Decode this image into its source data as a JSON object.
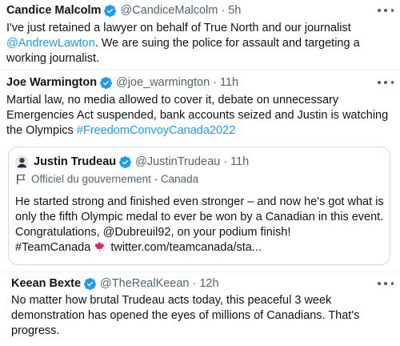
{
  "tweets": [
    {
      "name": "Candice Malcolm",
      "handle": "@CandiceMalcolm",
      "sep": "·",
      "time": "5h",
      "line1": "I've just retained a lawyer on behalf of True North and our journalist",
      "mention": "@AndrewLawton",
      "line2_rest": ". We are suing the police for assault and targeting a",
      "line3": "working journalist."
    },
    {
      "name": "Joe Warmington",
      "handle": "@joe_warmington",
      "sep": "·",
      "time": "11h",
      "line1": "Martial law, no media allowed to cover it, debate on unnecessary",
      "line2": "Emergencies Act suspended, bank accounts seized and Justin is watching",
      "line3_pre": "the Olympics ",
      "hashtag": "#FreedomConvoyCanada2022"
    },
    {
      "name": "Keean Bexte",
      "handle": "@TheRealKeean",
      "sep": "·",
      "time": "12h",
      "line1": "No matter how brutal Trudeau acts today, this peaceful 3 week",
      "line2": "demonstration has opened the eyes of millions of Canadians. That's",
      "line3": "progress."
    }
  ],
  "quote": {
    "name": "Justin Trudeau",
    "handle": "@JustinTrudeau",
    "sep": "·",
    "time": "11h",
    "gov_label": "Officiel du gouvernement - Canada",
    "line1": "He started strong and finished even stronger – and now he's got what is",
    "line2": "only the fifth Olympic medal to ever be won by a Canadian in this event.",
    "line3": "Congratulations, @Dubreuil92, on your podium finish!",
    "line4_tag": "#TeamCanada",
    "line4_link": " twitter.com/teamcanada/sta..."
  },
  "colors": {
    "link": "#1d9bf0",
    "verified": "#1d9bf0",
    "muted": "#536471",
    "maple": "#e0245e"
  },
  "icons": {
    "verified": "verified-badge-icon",
    "more": "more-options-icon",
    "gov": "government-flag-icon",
    "maple": "maple-leaf-icon"
  }
}
